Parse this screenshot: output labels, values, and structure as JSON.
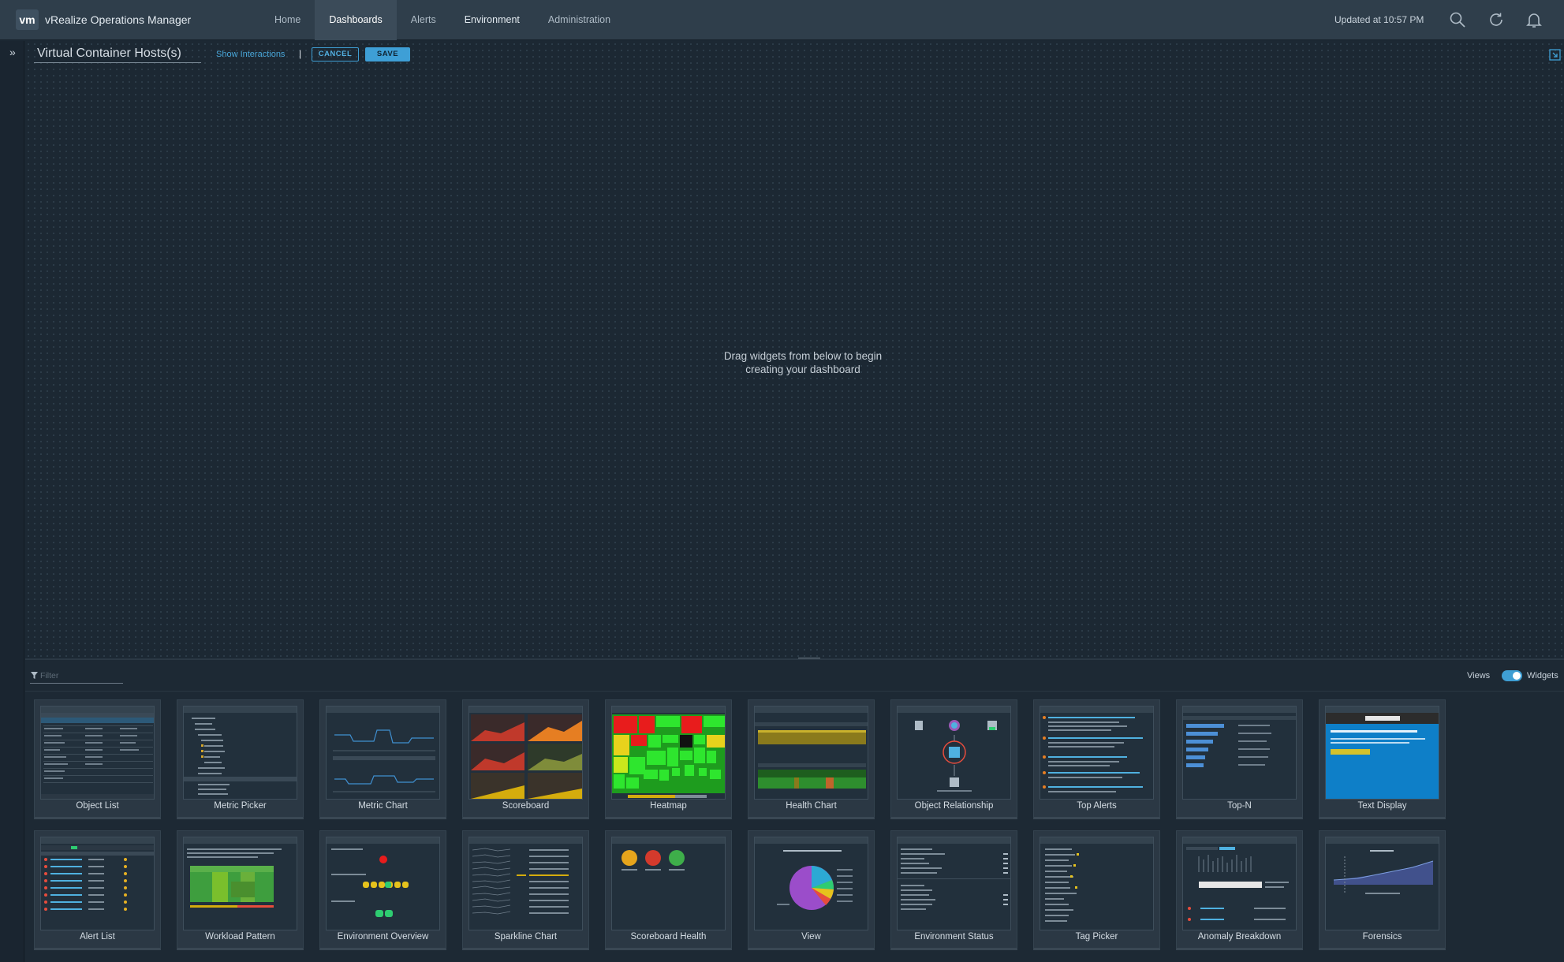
{
  "app": {
    "logo": "vm",
    "title": "vRealize Operations Manager"
  },
  "nav": [
    {
      "label": "Home"
    },
    {
      "label": "Dashboards"
    },
    {
      "label": "Alerts"
    },
    {
      "label": "Environment"
    },
    {
      "label": "Administration"
    }
  ],
  "header": {
    "updated": "Updated at 10:57 PM"
  },
  "toolbar": {
    "dashboard_title": "Virtual Container Hosts(s)",
    "show_interactions": "Show Interactions",
    "separator": "|",
    "cancel": "CANCEL",
    "save": "SAVE"
  },
  "canvas": {
    "message_line1": "Drag widgets from below to begin",
    "message_line2": "creating your dashboard"
  },
  "palette": {
    "filter_placeholder": "Filter",
    "views_label": "Views",
    "widgets_label": "Widgets",
    "toggle_state": "widgets",
    "widgets": [
      {
        "label": "Object List"
      },
      {
        "label": "Metric Picker"
      },
      {
        "label": "Metric Chart"
      },
      {
        "label": "Scoreboard"
      },
      {
        "label": "Heatmap"
      },
      {
        "label": "Health Chart"
      },
      {
        "label": "Object Relationship"
      },
      {
        "label": "Top Alerts"
      },
      {
        "label": "Top-N"
      },
      {
        "label": "Text Display"
      },
      {
        "label": "Alert List"
      },
      {
        "label": "Workload Pattern"
      },
      {
        "label": "Environment Overview"
      },
      {
        "label": "Sparkline Chart"
      },
      {
        "label": "Scoreboard Health"
      },
      {
        "label": "View"
      },
      {
        "label": "Environment Status"
      },
      {
        "label": "Tag Picker"
      },
      {
        "label": "Anomaly Breakdown"
      },
      {
        "label": "Forensics"
      }
    ]
  },
  "colors": {
    "accent": "#3e9fd6",
    "topbar": "#2f3e4b",
    "background": "#1c2833"
  }
}
